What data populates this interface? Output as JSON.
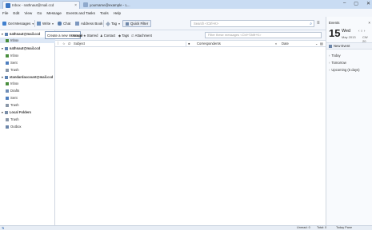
{
  "titlebar": {
    "tabs": [
      {
        "label": "Inbox - nathnaut@mail.ccd",
        "active": true
      },
      {
        "label": "yourname@example - L...",
        "active": false
      }
    ],
    "win_buttons": {
      "minimize": "–",
      "maximize": "▢",
      "close": "✕"
    }
  },
  "menubar": {
    "items": [
      "File",
      "Edit",
      "View",
      "Go",
      "Message",
      "Events and Tasks",
      "Tools",
      "Help"
    ]
  },
  "toolbar": {
    "get_messages": "Get Messages",
    "write": "Write",
    "chat": "Chat",
    "address_book": "Address Book",
    "tag": "Tag",
    "quick_filter": "Quick Filter",
    "search_placeholder": "Search <Ctrl+K>",
    "menu_glyph": "≡"
  },
  "folders": {
    "account1": "nathnaut@mail.ccd",
    "account1_inbox": "Inbox",
    "account2": "nathnaut@mail.ccd",
    "account2_items": [
      "Inbox",
      "Sent",
      "Trash"
    ],
    "account3": "standardaccount@mail.ccd",
    "account3_items": [
      "Inbox",
      "Drafts",
      "Sent",
      "Trash"
    ],
    "local": "Local Folders",
    "local_items": [
      "Trash",
      "Outbox"
    ]
  },
  "filterbar": {
    "create_filter": "Create a new message",
    "unread": "Unread",
    "starred": "Starred",
    "contact": "Contact",
    "tags": "Tags",
    "attachment": "Attachment",
    "filter_placeholder": "Filter these messages <Ctrl+Shift+K>"
  },
  "thread_columns": {
    "subject": "Subject",
    "correspondents": "Correspondents",
    "date": "Date"
  },
  "events": {
    "header": "Events",
    "day_number": "15",
    "day_name": "Wed",
    "month_year": "May 2013",
    "cw": "CW 20",
    "new_event": "New Event",
    "groups": [
      "Today",
      "Tomorrow",
      "Upcoming (5 days)"
    ]
  },
  "statusbar": {
    "unread": "Unread: 0",
    "total": "Total: 0",
    "today_pane": "Today Pane"
  }
}
